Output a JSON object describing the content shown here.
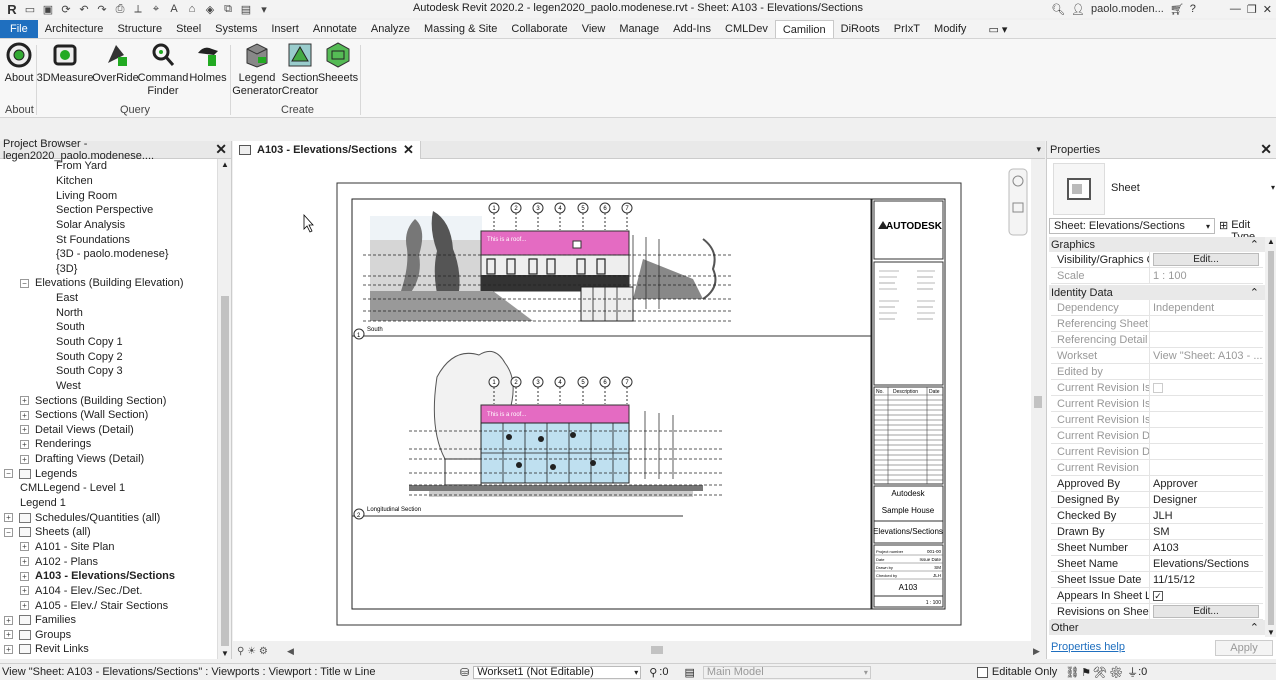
{
  "app": {
    "title": "Autodesk Revit 2020.2 - legen2020_paolo.modenese.rvt - Sheet: A103 - Elevations/Sections",
    "user": "paolo.moden..."
  },
  "ribbon": {
    "tabs": [
      "File",
      "Architecture",
      "Structure",
      "Steel",
      "Systems",
      "Insert",
      "Annotate",
      "Analyze",
      "Massing & Site",
      "Collaborate",
      "View",
      "Manage",
      "Add-Ins",
      "CMLDev",
      "Camilion",
      "DiRoots",
      "PrIxT",
      "Modify"
    ],
    "active_tab": "Camilion",
    "buttons": [
      {
        "label": "About",
        "icon": "about-icon"
      },
      {
        "label": "3DMeasure",
        "icon": "measure-icon"
      },
      {
        "label": "OverRide",
        "icon": "override-icon"
      },
      {
        "label": "Command\nFinder",
        "icon": "command-finder-icon"
      },
      {
        "label": "Holmes",
        "icon": "holmes-icon"
      },
      {
        "label": "Legend\nGenerator",
        "icon": "legend-generator-icon"
      },
      {
        "label": "Section\nCreator",
        "icon": "section-creator-icon"
      },
      {
        "label": "Sheeets",
        "icon": "sheets-icon"
      }
    ],
    "panels": [
      "About",
      "Query",
      "Create"
    ]
  },
  "project_browser": {
    "title": "Project Browser - legen2020_paolo.modenese....",
    "items": [
      {
        "label": "From Yard",
        "indent": 3
      },
      {
        "label": "Kitchen",
        "indent": 3
      },
      {
        "label": "Living Room",
        "indent": 3
      },
      {
        "label": "Section Perspective",
        "indent": 3
      },
      {
        "label": "Solar Analysis",
        "indent": 3
      },
      {
        "label": "St Foundations",
        "indent": 3
      },
      {
        "label": "{3D - paolo.modenese}",
        "indent": 3
      },
      {
        "label": "{3D}",
        "indent": 3
      },
      {
        "label": "Elevations (Building Elevation)",
        "indent": 2,
        "expander": "minus"
      },
      {
        "label": "East",
        "indent": 3
      },
      {
        "label": "North",
        "indent": 3
      },
      {
        "label": "South",
        "indent": 3
      },
      {
        "label": "South Copy 1",
        "indent": 3
      },
      {
        "label": "South Copy 2",
        "indent": 3
      },
      {
        "label": "South Copy 3",
        "indent": 3
      },
      {
        "label": "West",
        "indent": 3
      },
      {
        "label": "Sections (Building Section)",
        "indent": 2,
        "expander": "plus"
      },
      {
        "label": "Sections (Wall Section)",
        "indent": 2,
        "expander": "plus"
      },
      {
        "label": "Detail Views (Detail)",
        "indent": 2,
        "expander": "plus"
      },
      {
        "label": "Renderings",
        "indent": 2,
        "expander": "plus"
      },
      {
        "label": "Drafting Views (Detail)",
        "indent": 2,
        "expander": "plus"
      },
      {
        "label": "Legends",
        "indent": 1,
        "expander": "minus",
        "icon": true
      },
      {
        "label": "CMLLegend - Level 1",
        "indent": 2
      },
      {
        "label": "Legend 1",
        "indent": 2
      },
      {
        "label": "Schedules/Quantities (all)",
        "indent": 1,
        "expander": "plus",
        "icon": true
      },
      {
        "label": "Sheets (all)",
        "indent": 1,
        "expander": "minus",
        "icon": true
      },
      {
        "label": "A101 - Site Plan",
        "indent": 2,
        "expander": "plus"
      },
      {
        "label": "A102 - Plans",
        "indent": 2,
        "expander": "plus"
      },
      {
        "label": "A103 - Elevations/Sections",
        "indent": 2,
        "expander": "plus",
        "bold": true
      },
      {
        "label": "A104 - Elev./Sec./Det.",
        "indent": 2,
        "expander": "plus"
      },
      {
        "label": "A105 - Elev./ Stair Sections",
        "indent": 2,
        "expander": "plus"
      },
      {
        "label": "Families",
        "indent": 1,
        "expander": "plus",
        "icon": true
      },
      {
        "label": "Groups",
        "indent": 1,
        "expander": "plus",
        "icon": true
      },
      {
        "label": "Revit Links",
        "indent": 1,
        "expander": "plus",
        "icon": true
      }
    ]
  },
  "view_tab": {
    "label": "A103 - Elevations/Sections"
  },
  "sheet": {
    "brand": "AUTODESK",
    "note": "This is a roof...",
    "grid_bubbles": [
      "1",
      "2",
      "3",
      "4",
      "5",
      "6",
      "7"
    ],
    "view1_title": "South",
    "view1_num": "1",
    "view2_title": "Longitudinal Section",
    "view2_num": "2",
    "scale": "1 : 100",
    "rev_headers": [
      "No.",
      "Description",
      "Date"
    ],
    "company": "Autodesk",
    "project": "Sample House",
    "sheet_name": "Elevations/Sections",
    "sheet_number": "A103",
    "meta": [
      {
        "k": "Project number",
        "v": "001-00"
      },
      {
        "k": "Date",
        "v": "Issue Date"
      },
      {
        "k": "Drawn by",
        "v": "SM"
      },
      {
        "k": "Checked by",
        "v": "JLH"
      }
    ]
  },
  "properties": {
    "title": "Properties",
    "type_name": "Sheet",
    "selector": "Sheet: Elevations/Sections",
    "edit_type": "Edit Type",
    "groups": {
      "graphics": "Graphics",
      "identity": "Identity Data",
      "other": "Other"
    },
    "graphics_rows": [
      {
        "k": "Visibility/Graphics O...",
        "v": "Edit...",
        "button": true
      },
      {
        "k": "Scale",
        "v": "1 : 100",
        "dim": true
      }
    ],
    "identity_rows": [
      {
        "k": "Dependency",
        "v": "Independent",
        "dim": true
      },
      {
        "k": "Referencing Sheet",
        "v": "",
        "dim": true
      },
      {
        "k": "Referencing Detail",
        "v": "",
        "dim": true
      },
      {
        "k": "Workset",
        "v": "View \"Sheet: A103 - ...",
        "dim": true
      },
      {
        "k": "Edited by",
        "v": "",
        "dim": true
      },
      {
        "k": "Current Revision Iss...",
        "v": "",
        "dim": true,
        "checkbox": true
      },
      {
        "k": "Current Revision Iss...",
        "v": "",
        "dim": true
      },
      {
        "k": "Current Revision Iss...",
        "v": "",
        "dim": true
      },
      {
        "k": "Current Revision Date",
        "v": "",
        "dim": true
      },
      {
        "k": "Current Revision De...",
        "v": "",
        "dim": true
      },
      {
        "k": "Current Revision",
        "v": "",
        "dim": true
      },
      {
        "k": "Approved By",
        "v": "Approver"
      },
      {
        "k": "Designed By",
        "v": "Designer"
      },
      {
        "k": "Checked By",
        "v": "JLH"
      },
      {
        "k": "Drawn By",
        "v": "SM"
      },
      {
        "k": "Sheet Number",
        "v": "A103"
      },
      {
        "k": "Sheet Name",
        "v": "Elevations/Sections"
      },
      {
        "k": "Sheet Issue Date",
        "v": "11/15/12"
      },
      {
        "k": "Appears In Sheet List",
        "v": "",
        "checkbox": true,
        "checked": true
      },
      {
        "k": "Revisions on Sheet",
        "v": "Edit...",
        "button": true
      }
    ],
    "help": "Properties help",
    "apply": "Apply"
  },
  "status": {
    "message": "View \"Sheet: A103 - Elevations/Sections\" : Viewports : Viewport : Title w Line",
    "workset": "Workset1 (Not Editable)",
    "count": ":0",
    "model": "Main Model",
    "editable": "Editable Only",
    "filter": ":0"
  },
  "colors": {
    "accent": "#1f6fbf",
    "roof": "#e46bc2",
    "glass": "#bfe0f0"
  }
}
